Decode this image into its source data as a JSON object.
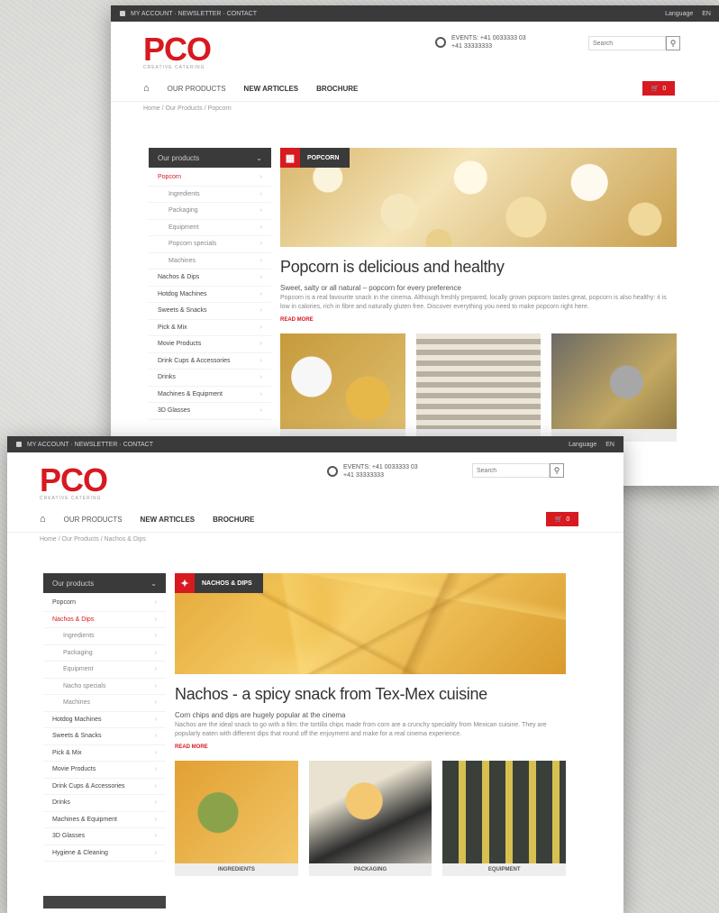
{
  "back": {
    "topbar": {
      "left": "MY ACCOUNT  ·  NEWSLETTER  ·  CONTACT",
      "lang": "Language",
      "currency": "EN"
    },
    "logo": {
      "word": "PCO",
      "tag": "CREATIVE CATERING"
    },
    "contact": {
      "line1": "EVENTS: +41 0033333 03",
      "line2": "+41 33333333"
    },
    "search_placeholder": "Search",
    "nav": [
      "OUR PRODUCTS",
      "NEW ARTICLES",
      "BROCHURE"
    ],
    "cart_label": "0",
    "crumb": "Home  /  Our Products  /  Popcorn",
    "sidebar": {
      "header": "Our products",
      "items": [
        {
          "label": "Popcorn",
          "type": "active"
        },
        {
          "label": "Ingredients",
          "type": "sub"
        },
        {
          "label": "Packaging",
          "type": "sub"
        },
        {
          "label": "Equipment",
          "type": "sub"
        },
        {
          "label": "Popcorn specials",
          "type": "sub"
        },
        {
          "label": "Machines",
          "type": "sub"
        },
        {
          "label": "Nachos & Dips",
          "type": ""
        },
        {
          "label": "Hotdog Machines",
          "type": ""
        },
        {
          "label": "Sweets & Snacks",
          "type": ""
        },
        {
          "label": "Pick & Mix",
          "type": ""
        },
        {
          "label": "Movie Products",
          "type": ""
        },
        {
          "label": "Drink Cups & Accessories",
          "type": ""
        },
        {
          "label": "Drinks",
          "type": ""
        },
        {
          "label": "Machines & Equipment",
          "type": ""
        },
        {
          "label": "3D Glasses",
          "type": ""
        }
      ]
    },
    "hero_label": "POPCORN",
    "title": "Popcorn is delicious and healthy",
    "lead": "Sweet, salty or all natural – popcorn for every preference",
    "desc": "Popcorn is a real favourite snack in the cinema. Although freshly prepared, locally grown popcorn tastes great, popcorn is also healthy: it is low in calories, rich in fibre and naturally gluten free. Discover everything you need to make popcorn right here.",
    "readmore": "READ MORE",
    "tiles": [
      "",
      "",
      ""
    ]
  },
  "front": {
    "topbar": {
      "left": "MY ACCOUNT  ·  NEWSLETTER  ·  CONTACT",
      "lang": "Language",
      "currency": "EN"
    },
    "logo": {
      "word": "PCO",
      "tag": "CREATIVE CATERING"
    },
    "contact": {
      "line1": "EVENTS: +41 0033333 03",
      "line2": "+41 33333333"
    },
    "search_placeholder": "Search",
    "nav": [
      "OUR PRODUCTS",
      "NEW ARTICLES",
      "BROCHURE"
    ],
    "cart_label": "0",
    "crumb": "Home  /  Our Products  /  Nachos & Dips",
    "sidebar": {
      "header": "Our products",
      "items": [
        {
          "label": "Popcorn",
          "type": ""
        },
        {
          "label": "Nachos & Dips",
          "type": "active"
        },
        {
          "label": "Ingredients",
          "type": "sub"
        },
        {
          "label": "Packaging",
          "type": "sub"
        },
        {
          "label": "Equipment",
          "type": "sub"
        },
        {
          "label": "Nacho specials",
          "type": "sub"
        },
        {
          "label": "Machines",
          "type": "sub"
        },
        {
          "label": "Hotdog Machines",
          "type": ""
        },
        {
          "label": "Sweets & Snacks",
          "type": ""
        },
        {
          "label": "Pick & Mix",
          "type": ""
        },
        {
          "label": "Movie Products",
          "type": ""
        },
        {
          "label": "Drink Cups & Accessories",
          "type": ""
        },
        {
          "label": "Drinks",
          "type": ""
        },
        {
          "label": "Machines & Equipment",
          "type": ""
        },
        {
          "label": "3D Glasses",
          "type": ""
        },
        {
          "label": "Hygiene & Cleaning",
          "type": ""
        }
      ]
    },
    "hero_label": "NACHOS & DIPS",
    "title": "Nachos - a spicy snack from Tex-Mex cuisine",
    "lead": "Corn chips and dips are hugely popular at the cinema",
    "desc": "Nachos are the ideal snack to go with a film: the tortilla chips made from corn are a crunchy speciality from Mexican cuisine. They are popularly eaten with different dips that round off the enjoyment and make for a real cinema experience.",
    "readmore": "READ MORE",
    "tiles": [
      "INGREDIENTS",
      "PACKAGING",
      "EQUIPMENT"
    ]
  }
}
